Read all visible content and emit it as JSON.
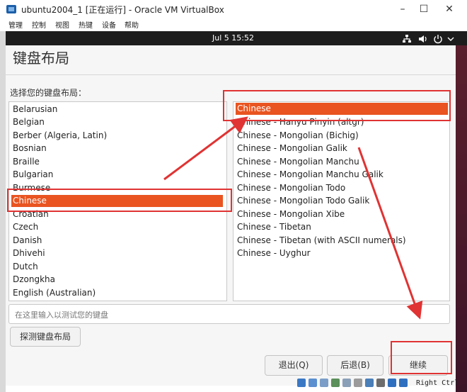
{
  "window": {
    "title": "ubuntu2004_1 [正在运行] - Oracle VM VirtualBox",
    "icon": "virtualbox-icon",
    "controls": [
      "minimize",
      "maximize",
      "close"
    ]
  },
  "menubar": [
    "管理",
    "控制",
    "视图",
    "热键",
    "设备",
    "帮助"
  ],
  "topbar": {
    "clock": "Jul 5  15:52",
    "icons": [
      "network-icon",
      "volume-icon",
      "power-icon",
      "chevron-down-icon"
    ]
  },
  "installer": {
    "title": "键盘布局",
    "list_label": "选择您的键盘布局：",
    "layouts": [
      "Belarusian",
      "Belgian",
      "Berber (Algeria, Latin)",
      "Bosnian",
      "Braille",
      "Bulgarian",
      "Burmese",
      "Chinese",
      "Croatian",
      "Czech",
      "Danish",
      "Dhivehi",
      "Dutch",
      "Dzongkha",
      "English (Australian)"
    ],
    "selected_layout": "Chinese",
    "variants": [
      "Chinese",
      "Chinese - Hanyu Pinyin (altgr)",
      "Chinese - Mongolian (Bichig)",
      "Chinese - Mongolian Galik",
      "Chinese - Mongolian Manchu",
      "Chinese - Mongolian Manchu Galik",
      "Chinese - Mongolian Todo",
      "Chinese - Mongolian Todo Galik",
      "Chinese - Mongolian Xibe",
      "Chinese - Tibetan",
      "Chinese - Tibetan (with ASCII numerals)",
      "Chinese - Uyghur"
    ],
    "selected_variant": "Chinese",
    "test_placeholder": "在这里输入以测试您的键盘",
    "detect_button": "探测键盘布局",
    "quit_button": "退出(Q)",
    "back_button": "后退(B)",
    "continue_button": "继续"
  },
  "statusbar": {
    "host_key": "Right Ctrl"
  },
  "colors": {
    "accent": "#e95420",
    "annotation": "#e03333",
    "topbar": "#1d1d1d"
  }
}
